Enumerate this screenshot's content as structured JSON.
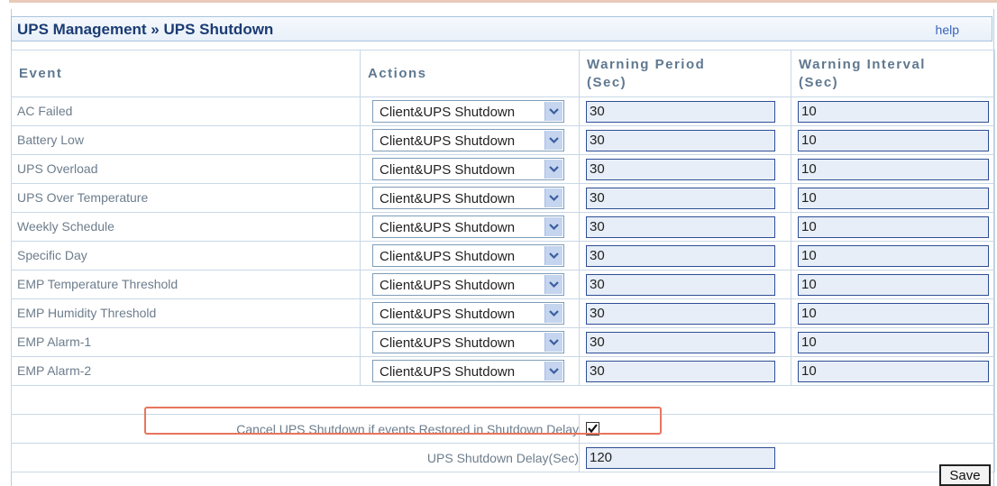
{
  "header": {
    "title": "UPS Management » UPS Shutdown",
    "help_label": "help"
  },
  "columns": {
    "event": "Event",
    "actions": "Actions",
    "warning_period": [
      "Warning Period",
      "(Sec)"
    ],
    "warning_interval": [
      "Warning Interval",
      "(Sec)"
    ]
  },
  "rows": [
    {
      "event": "AC Failed",
      "action": "Client&UPS Shutdown",
      "period": "30",
      "interval": "10"
    },
    {
      "event": "Battery Low",
      "action": "Client&UPS Shutdown",
      "period": "30",
      "interval": "10"
    },
    {
      "event": "UPS Overload",
      "action": "Client&UPS Shutdown",
      "period": "30",
      "interval": "10"
    },
    {
      "event": "UPS Over Temperature",
      "action": "Client&UPS Shutdown",
      "period": "30",
      "interval": "10"
    },
    {
      "event": "Weekly Schedule",
      "action": "Client&UPS Shutdown",
      "period": "30",
      "interval": "10"
    },
    {
      "event": "Specific Day",
      "action": "Client&UPS Shutdown",
      "period": "30",
      "interval": "10"
    },
    {
      "event": "EMP Temperature Threshold",
      "action": "Client&UPS Shutdown",
      "period": "30",
      "interval": "10"
    },
    {
      "event": "EMP Humidity Threshold",
      "action": "Client&UPS Shutdown",
      "period": "30",
      "interval": "10"
    },
    {
      "event": "EMP Alarm-1",
      "action": "Client&UPS Shutdown",
      "period": "30",
      "interval": "10"
    },
    {
      "event": "EMP Alarm-2",
      "action": "Client&UPS Shutdown",
      "period": "30",
      "interval": "10"
    }
  ],
  "cancel_option": {
    "label": "Cancel UPS Shutdown if events Restored in Shutdown Delay",
    "checked": true
  },
  "shutdown_delay": {
    "label": "UPS Shutdown Delay(Sec)",
    "value": "120"
  },
  "save_label": "Save",
  "colors": {
    "title": "#1b3c73",
    "header_text": "#5f7890",
    "label_text": "#6d7d8c",
    "highlight": "#e8755d",
    "input_bg": "#e7eef7",
    "input_border": "#2e4d95"
  }
}
